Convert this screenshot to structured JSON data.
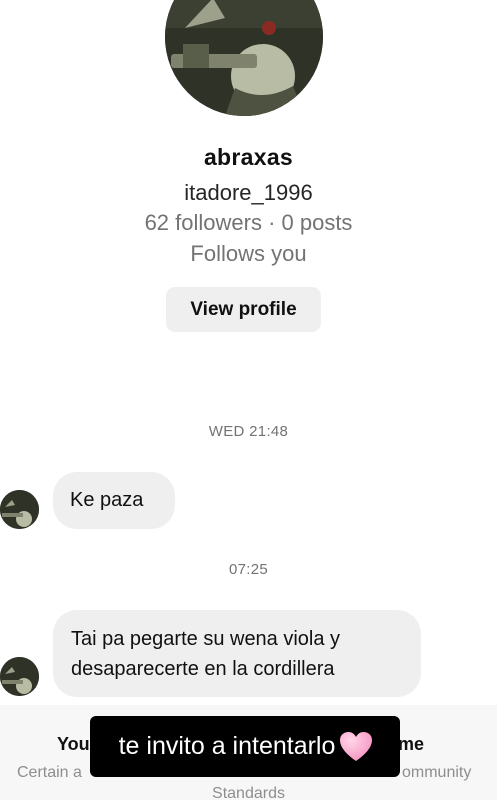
{
  "profile": {
    "display_name": "abraxas",
    "username": "itadore_1996",
    "stats": "62 followers · 0 posts",
    "follows_you": "Follows you",
    "view_profile_label": "View profile"
  },
  "thread": [
    {
      "timestamp": "WED 21:48",
      "message": "Ke paza"
    },
    {
      "timestamp": "07:25",
      "message_lines": [
        "Tai pa pegarte su wena viola y",
        "desaparecerte en la cordillera"
      ]
    }
  ],
  "notice": {
    "title_left": "You",
    "title_right": "me",
    "body_line1_left": "Certain a",
    "body_line1_right": "ommunity",
    "body_line2": "Standards"
  },
  "story_caption": {
    "text": "te invito a intentarlo",
    "emoji": "pink-heart-icon"
  },
  "colors": {
    "bubble": "#efefef",
    "secondary_text": "#737373",
    "caption_bg": "#000000",
    "heart": "#f7a6c9"
  }
}
